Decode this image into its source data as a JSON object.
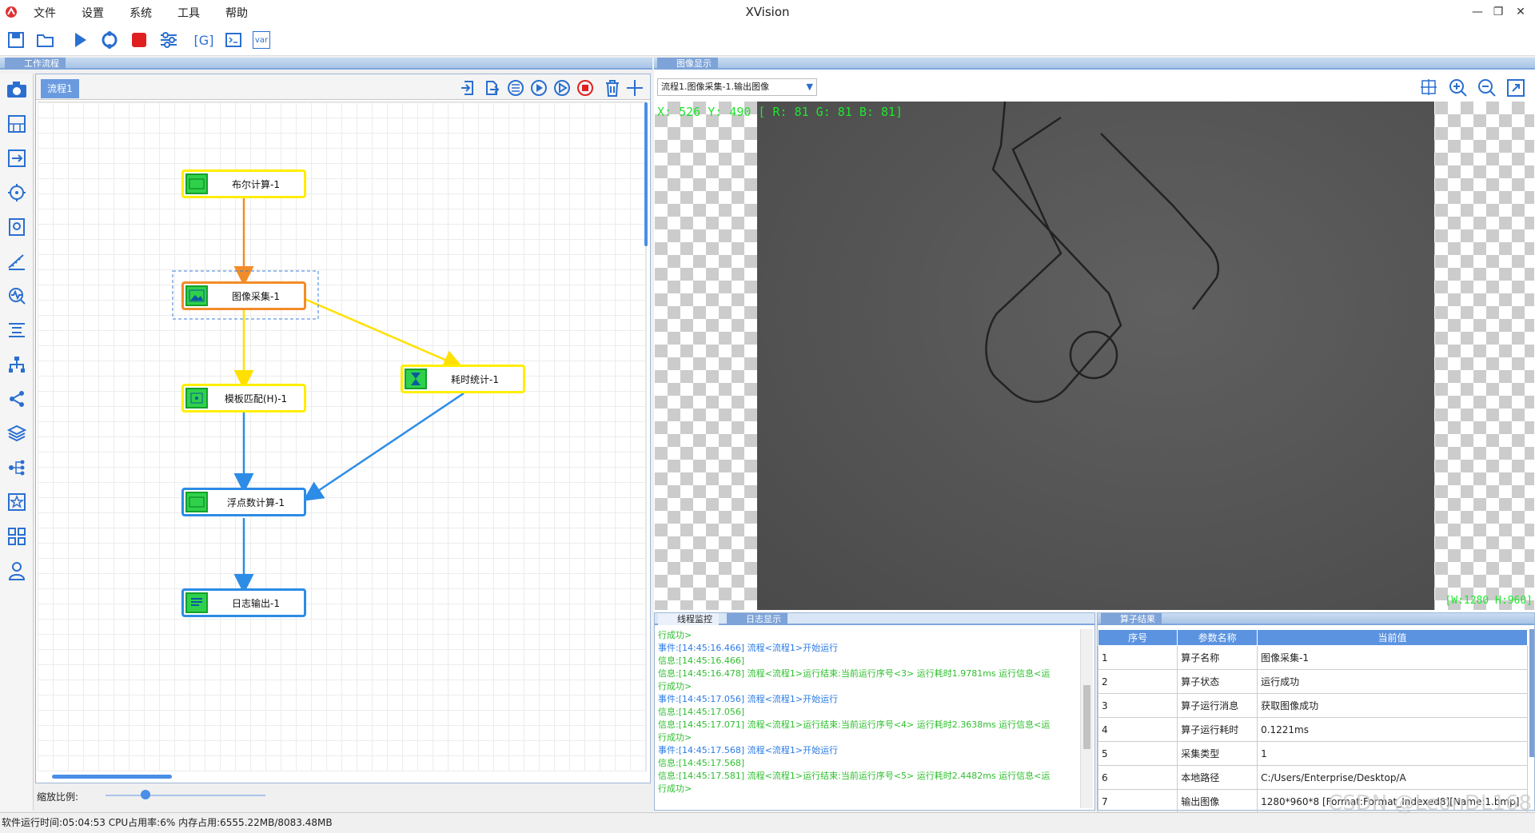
{
  "app": {
    "title": "XVision"
  },
  "menu": [
    "文件",
    "设置",
    "系统",
    "工具",
    "帮助"
  ],
  "toolbar": {
    "icons": [
      "save-icon",
      "open-folder-icon",
      "run-icon",
      "loop-icon",
      "stop-icon",
      "settings-sliders-icon",
      "global-var-icon",
      "script-icon",
      "variable-icon"
    ],
    "global_label": "[G]",
    "var_label": "var"
  },
  "left_icons": [
    "camera-icon",
    "grid-icon",
    "transform-icon",
    "target-icon",
    "image-search-icon",
    "ruler-icon",
    "wave-icon",
    "align-icon",
    "hierarchy-icon",
    "network-icon",
    "layers-icon",
    "tree-icon",
    "star-icon",
    "apps-icon",
    "user-icon"
  ],
  "workflow": {
    "panel_title": "工作流程",
    "tab": "流程1",
    "nodes": [
      {
        "id": "bool",
        "label": "布尔计算-1",
        "state": "normal"
      },
      {
        "id": "acq",
        "label": "图像采集-1",
        "state": "selected"
      },
      {
        "id": "match",
        "label": "模板匹配(H)-1",
        "state": "normal"
      },
      {
        "id": "timing",
        "label": "耗时统计-1",
        "state": "normal"
      },
      {
        "id": "float",
        "label": "浮点数计算-1",
        "state": "blue"
      },
      {
        "id": "log",
        "label": "日志输出-1",
        "state": "blue"
      }
    ],
    "zoom_label": "缩放比例:",
    "zoom_level": 0.25
  },
  "image_panel": {
    "title": "图像显示",
    "selector": "流程1.图像采集-1.输出图像",
    "pixel_readout": "X: 526 Y: 490 [ R: 81 G: 81 B: 81]",
    "size_readout": "[W:1280 H:960]"
  },
  "log_panel": {
    "tabs": [
      "线程监控",
      "日志显示"
    ],
    "lines": [
      {
        "type": "info",
        "text": "行成功>"
      },
      {
        "type": "ev",
        "text": "事件:[14:45:16.466] 流程<流程1>开始运行"
      },
      {
        "type": "info",
        "text": "信息:[14:45:16.466]"
      },
      {
        "type": "info",
        "text": "信息:[14:45:16.478] 流程<流程1>运行结束:当前运行序号<3> 运行耗时1.9781ms 运行信息<运"
      },
      {
        "type": "info",
        "text": "行成功>"
      },
      {
        "type": "ev",
        "text": "事件:[14:45:17.056] 流程<流程1>开始运行"
      },
      {
        "type": "info",
        "text": "信息:[14:45:17.056]"
      },
      {
        "type": "info",
        "text": "信息:[14:45:17.071] 流程<流程1>运行结束:当前运行序号<4> 运行耗时2.3638ms 运行信息<运"
      },
      {
        "type": "info",
        "text": "行成功>"
      },
      {
        "type": "ev",
        "text": "事件:[14:45:17.568] 流程<流程1>开始运行"
      },
      {
        "type": "info",
        "text": "信息:[14:45:17.568]"
      },
      {
        "type": "info",
        "text": "信息:[14:45:17.581] 流程<流程1>运行结束:当前运行序号<5> 运行耗时2.4482ms 运行信息<运"
      },
      {
        "type": "info",
        "text": "行成功>"
      }
    ]
  },
  "result_panel": {
    "title": "算子结果",
    "columns": [
      "序号",
      "参数名称",
      "当前值"
    ],
    "rows": [
      [
        "1",
        "算子名称",
        "图像采集-1"
      ],
      [
        "2",
        "算子状态",
        "运行成功"
      ],
      [
        "3",
        "算子运行消息",
        "获取图像成功"
      ],
      [
        "4",
        "算子运行耗时",
        "0.1221ms"
      ],
      [
        "5",
        "采集类型",
        "1"
      ],
      [
        "6",
        "本地路径",
        "C:/Users/Enterprise/Desktop/A"
      ],
      [
        "7",
        "输出图像",
        "1280*960*8 [Format:Format_Indexed8][Name:1.bmp]"
      ]
    ]
  },
  "status": {
    "runtime": "软件运行时间:05:04:53",
    "cpu": "CPU占用率:6%",
    "mem": "内存占用:6555.22MB/8083.48MB"
  },
  "watermark": "CSDN @LeonDL168",
  "colors": {
    "accent": "#5b93e0",
    "node_yellow": "#ffee00",
    "node_orange": "#f28c28",
    "edge_blue": "#2c8ce6",
    "green_text": "#1ee62d"
  }
}
